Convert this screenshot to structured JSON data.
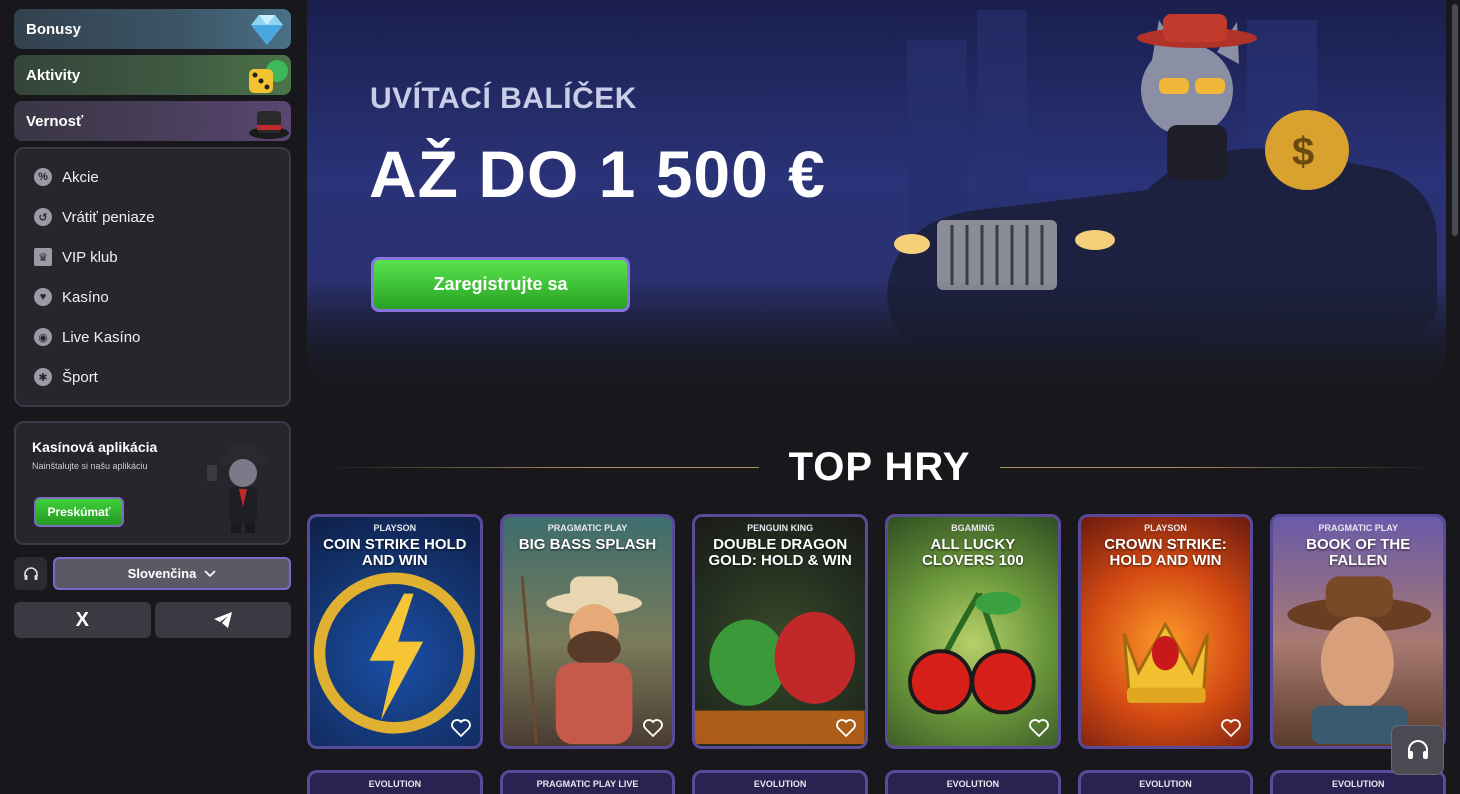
{
  "sidebar": {
    "promos": [
      {
        "label": "Bonusy",
        "icon": "diamond-icon"
      },
      {
        "label": "Aktivity",
        "icon": "dice-icon"
      },
      {
        "label": "Vernosť",
        "icon": "hat-icon"
      }
    ],
    "menu": [
      {
        "label": "Akcie",
        "icon": "promo-icon"
      },
      {
        "label": "Vrátiť peniaze",
        "icon": "cashback-icon"
      },
      {
        "label": "VIP klub",
        "icon": "crown-icon"
      },
      {
        "label": "Kasíno",
        "icon": "casino-icon"
      },
      {
        "label": "Live Kasíno",
        "icon": "live-casino-icon"
      },
      {
        "label": "Šport",
        "icon": "sport-icon"
      }
    ],
    "app_card": {
      "title": "Kasínová aplikácia",
      "subtitle": "Nainštalujte si našu aplikáciu",
      "button": "Preskúmať"
    },
    "language": "Slovenčina",
    "social": [
      "X",
      "Telegram"
    ]
  },
  "hero": {
    "subtitle": "UVÍTACÍ BALÍČEK",
    "title": "AŽ DO 1 500 €",
    "cta": "Zaregistrujte sa"
  },
  "top_games": {
    "title": "TOP HRY",
    "games": [
      {
        "provider": "PLAYSON",
        "name": "COIN STRIKE HOLD AND WIN"
      },
      {
        "provider": "PRAGMATIC PLAY",
        "name": "BIG BASS SPLASH"
      },
      {
        "provider": "PENGUIN KING",
        "name": "DOUBLE DRAGON GOLD: HOLD & WIN"
      },
      {
        "provider": "BGAMING",
        "name": "ALL LUCKY CLOVERS 100"
      },
      {
        "provider": "PLAYSON",
        "name": "CROWN STRIKE: HOLD AND WIN"
      },
      {
        "provider": "PRAGMATIC PLAY",
        "name": "BOOK OF THE FALLEN"
      }
    ],
    "next_row_providers": [
      "EVOLUTION",
      "PRAGMATIC PLAY LIVE",
      "EVOLUTION",
      "EVOLUTION",
      "EVOLUTION",
      "EVOLUTION"
    ]
  },
  "colors": {
    "accent_green": "#3fcf3a",
    "border_purple": "#7a68c8",
    "background": "#17171c"
  }
}
